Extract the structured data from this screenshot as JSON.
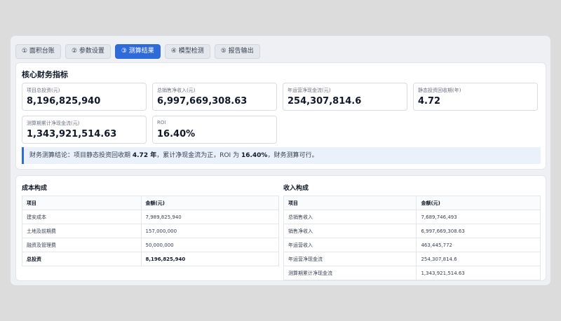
{
  "tabs": [
    {
      "label": "① 面积台账",
      "active": false
    },
    {
      "label": "② 参数设置",
      "active": false
    },
    {
      "label": "③ 测算结果",
      "active": true
    },
    {
      "label": "④ 模型检测",
      "active": false
    },
    {
      "label": "⑤ 报告输出",
      "active": false
    }
  ],
  "metrics": {
    "title": "核心财务指标",
    "cards": [
      {
        "label": "项目总投资(元)",
        "value": "8,196,825,940"
      },
      {
        "label": "总销售净收入(元)",
        "value": "6,997,669,308.63"
      },
      {
        "label": "年运营净现金流(元)",
        "value": "254,307,814.6"
      },
      {
        "label": "静态投资回收期(年)",
        "value": "4.72"
      },
      {
        "label": "测算期累计净现金流(元)",
        "value": "1,343,921,514.63"
      },
      {
        "label": "ROI",
        "value": "16.40%"
      }
    ],
    "conclusion": {
      "prefix": "财务测算结论：项目静态投资回收期 ",
      "payback": "4.72 年",
      "middle": "，累计净现金流为正，ROI 为 ",
      "roi": "16.40%",
      "suffix": "，财务测算可行。"
    }
  },
  "cost_table": {
    "title": "成本构成",
    "headers": [
      "项目",
      "金额(元)"
    ],
    "rows": [
      [
        "建安成本",
        "7,989,825,940"
      ],
      [
        "土地及前期费",
        "157,000,000"
      ],
      [
        "融资及管理费",
        "50,000,000"
      ],
      [
        "总投资",
        "8,196,825,940"
      ]
    ]
  },
  "revenue_table": {
    "title": "收入构成",
    "headers": [
      "项目",
      "金额(元)"
    ],
    "rows": [
      [
        "总销售收入",
        "7,689,746,493"
      ],
      [
        "销售净收入",
        "6,997,669,308.63"
      ],
      [
        "年运营收入",
        "463,445,772"
      ],
      [
        "年运营净现金流",
        "254,307,814.6"
      ],
      [
        "测算期累计净现金流",
        "1,343,921,514.63"
      ]
    ]
  },
  "colors": {
    "accent": "#2f6bd8",
    "background": "#eef0f4"
  }
}
